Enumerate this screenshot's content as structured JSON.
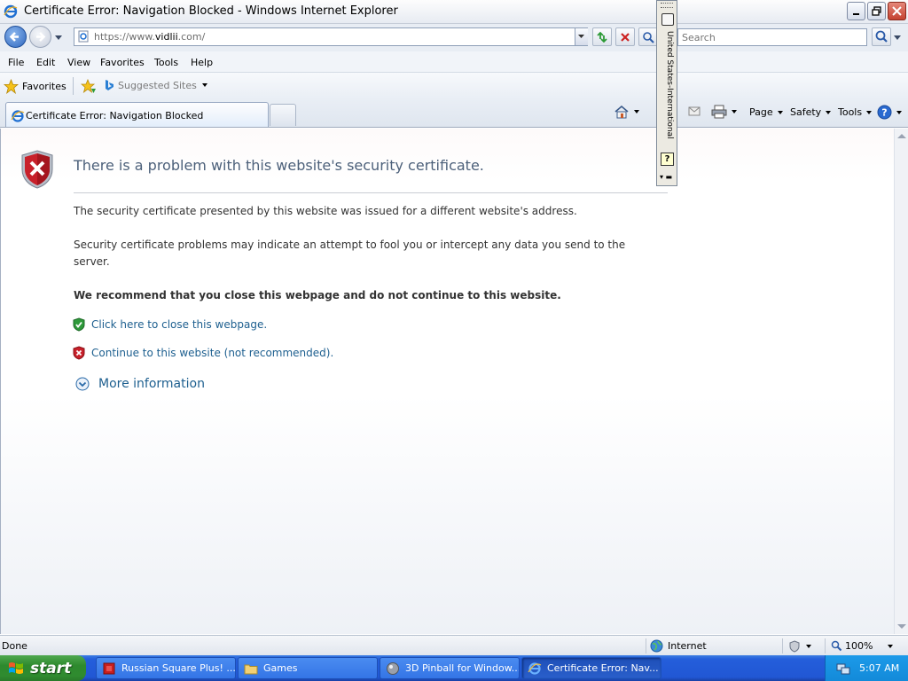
{
  "window": {
    "title": "Certificate Error: Navigation Blocked - Windows Internet Explorer"
  },
  "address_bar": {
    "url_prefix": "https://www.",
    "url_domain": "vidlii",
    "url_suffix": ".com/",
    "search_placeholder": "Search"
  },
  "menu": [
    "File",
    "Edit",
    "View",
    "Favorites",
    "Tools",
    "Help"
  ],
  "favorites_bar": {
    "favorites_label": "Favorites",
    "suggested_label": "Suggested Sites"
  },
  "tab": {
    "label": "Certificate Error: Navigation Blocked"
  },
  "command_bar": {
    "page_label": "Page",
    "safety_label": "Safety",
    "tools_label": "Tools"
  },
  "content": {
    "heading": "There is a problem with this website's security certificate.",
    "paragraph1": "The security certificate presented by this website was issued for a different website's address.",
    "paragraph2": "Security certificate problems may indicate an attempt to fool you or intercept any data you send to the server.",
    "recommendation": "We recommend that you close this webpage and do not continue to this website.",
    "close_link": "Click here to close this webpage.",
    "continue_link": "Continue to this website (not recommended).",
    "more_info": "More information"
  },
  "language_bar": {
    "language": "United States-International"
  },
  "status_bar": {
    "status": "Done",
    "zone": "Internet",
    "zoom": "100%"
  },
  "taskbar": {
    "start_label": "start",
    "tasks": [
      {
        "label": "Russian Square Plus! ..."
      },
      {
        "label": "Games"
      },
      {
        "label": "3D Pinball for Window..."
      },
      {
        "label": "Certificate Error: Nav..."
      }
    ],
    "clock": "5:07 AM"
  },
  "colors": {
    "heading": "#4c607a",
    "link": "#1d5f8f",
    "shield_red": "#c8202a",
    "shield_green": "#2e9a3a",
    "taskbar_blue": "#245edb",
    "start_green": "#2e8a2e"
  }
}
